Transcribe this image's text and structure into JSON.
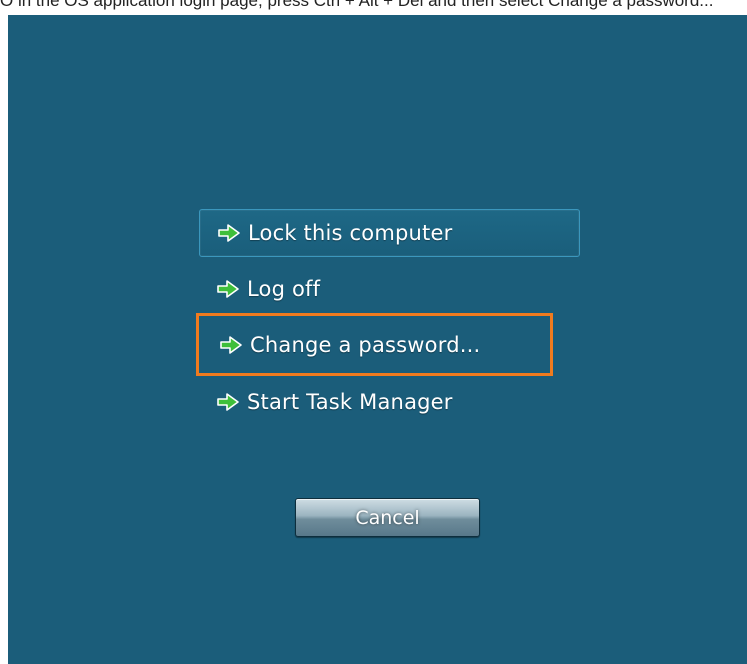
{
  "caption": {
    "text": "O in the OS application login page, press Ctrl + Alt + Del and then select Change a password..."
  },
  "security_screen": {
    "options": {
      "lock": {
        "label": "Lock this computer",
        "icon": "green-arrow-icon"
      },
      "logoff": {
        "label": "Log off",
        "icon": "green-arrow-icon"
      },
      "change_password": {
        "label": "Change a password...",
        "icon": "green-arrow-icon",
        "highlighted": true
      },
      "task_manager": {
        "label": "Start Task Manager",
        "icon": "green-arrow-icon"
      }
    },
    "cancel_label": "Cancel"
  },
  "colors": {
    "background": "#1b5d7a",
    "highlight_border": "#f07b1e",
    "focus_border": "#3b97bd",
    "arrow": "#3fbf3a"
  }
}
